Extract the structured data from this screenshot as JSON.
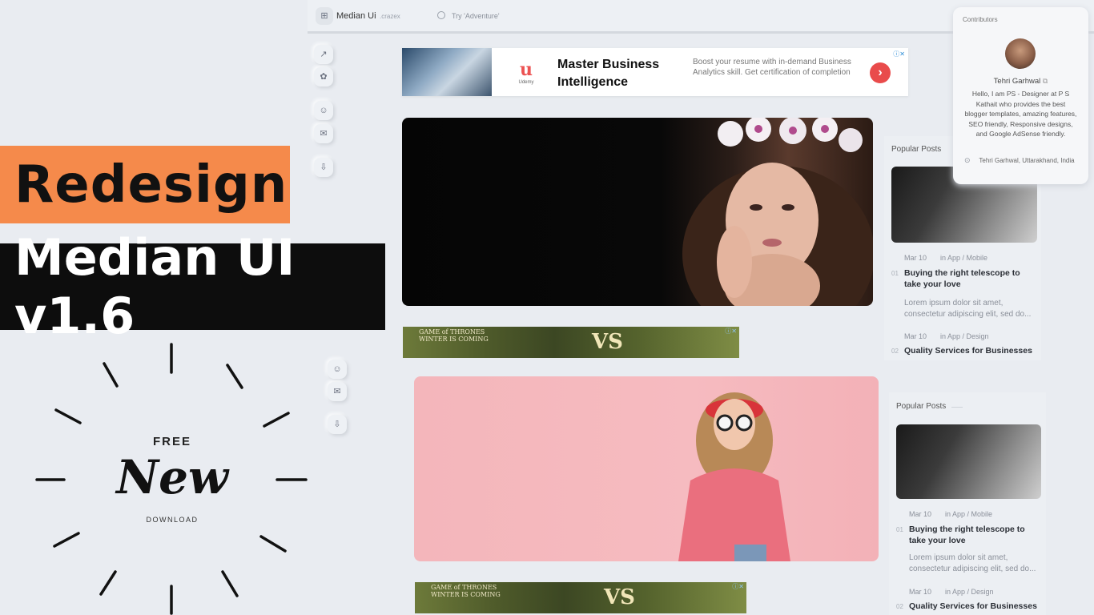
{
  "promo": {
    "line1": "Redesign",
    "line2": "Median UI v1.6",
    "free": "FREE",
    "new": "New",
    "download": "DOWNLOAD"
  },
  "topbar": {
    "brand": "Median Ui",
    "brand_tag": ".crazex",
    "search_placeholder": "Try 'Adventure'"
  },
  "icons": {
    "logo": "grid-icon",
    "search": "search-icon",
    "rail": [
      "trending-icon",
      "settings-icon",
      "users-icon",
      "mail-icon",
      "download-icon"
    ]
  },
  "ad_top": {
    "logo": "u",
    "logo_sub": "Udemy",
    "title": "Master Business Intelligence",
    "description": "Boost your resume with in-demand Business Analytics skill. Get certification of completion",
    "cta": "›",
    "info": "ⓘ✕"
  },
  "ad_got": {
    "title": "GAME of THRONES",
    "subtitle": "WINTER IS COMING",
    "vs": "VS",
    "info": "ⓘ✕"
  },
  "sidebar": {
    "heading": "Popular Posts",
    "posts": [
      {
        "date": "Mar 10",
        "category": "in App / Mobile",
        "num": "01",
        "title": "Buying the right telescope to take your love",
        "excerpt": "Lorem ipsum dolor sit amet, consectetur adipiscing elit, sed do..."
      },
      {
        "date": "Mar 10",
        "category": "in App / Design",
        "num": "02",
        "title": "Quality Services for Businesses"
      }
    ]
  },
  "contributors": {
    "label": "Contributors",
    "name": "Tehri Garhwal",
    "name_icon": "external-link-icon",
    "bio": "Hello, I am PS - Designer at P S Kathait who provides the best blogger templates, amazing features, SEO friendly, Responsive designs, and Google AdSense friendly.",
    "location": "Tehri Garhwal, Uttarakhand, India"
  },
  "colors": {
    "promo_orange": "#f58a4b",
    "promo_black": "#0d0d0d",
    "background": "#e9ecf1",
    "ad_cta": "#e94b4b",
    "hero_pink": "#f4b6bb"
  }
}
